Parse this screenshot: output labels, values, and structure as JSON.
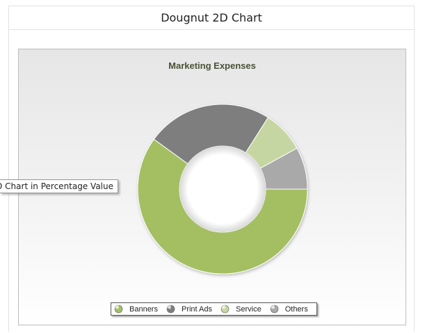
{
  "header": {
    "title": "Dougnut 2D Chart"
  },
  "tooltip": {
    "text": "D Chart in Percentage Value"
  },
  "chart_data": {
    "type": "doughnut",
    "title": "Marketing Expenses",
    "categories": [
      "Banners",
      "Print Ads",
      "Service",
      "Others"
    ],
    "values": [
      60,
      24,
      8,
      8
    ],
    "colors": [
      "#a4bf62",
      "#7e7e7e",
      "#c6d6a2",
      "#a9a9a9"
    ],
    "legend": "bottom",
    "start_angle_deg": 0
  }
}
